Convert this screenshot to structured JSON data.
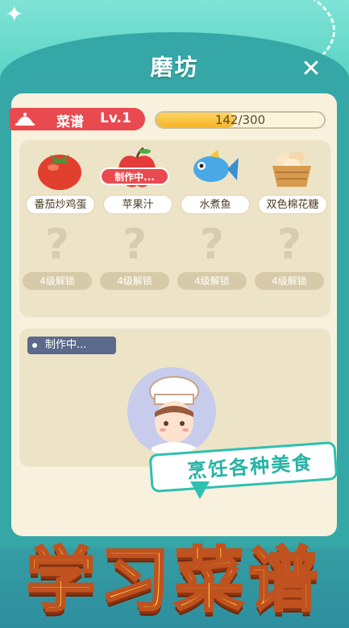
{
  "window": {
    "title": "磨坊",
    "close_icon": "close-icon"
  },
  "header": {
    "recipe_label": "菜谱",
    "level": "Lv.1",
    "progress_text": "142/300",
    "progress_current": 142,
    "progress_max": 300
  },
  "recipes": [
    {
      "name": "番茄炒鸡蛋",
      "icon": "tomato-icon"
    },
    {
      "name": "苹果汁",
      "icon": "apple-icon",
      "badge": "制作中..."
    },
    {
      "name": "水煮鱼",
      "icon": "fish-icon"
    },
    {
      "name": "双色棉花糖",
      "icon": "basket-icon"
    }
  ],
  "locked": [
    {
      "mark": "?",
      "label": "4级解锁"
    },
    {
      "mark": "?",
      "label": "4级解锁"
    },
    {
      "mark": "?",
      "label": "4级解锁"
    },
    {
      "mark": "?",
      "label": "4级解锁"
    }
  ],
  "work": {
    "status": "制作中..."
  },
  "promo": {
    "banner": "烹饪各种美食",
    "title": "学习菜谱"
  },
  "colors": {
    "accent_red": "#e84a4f",
    "teal": "#35a7a6",
    "yellow": "#ffd84a",
    "panel": "#f7f1de"
  }
}
